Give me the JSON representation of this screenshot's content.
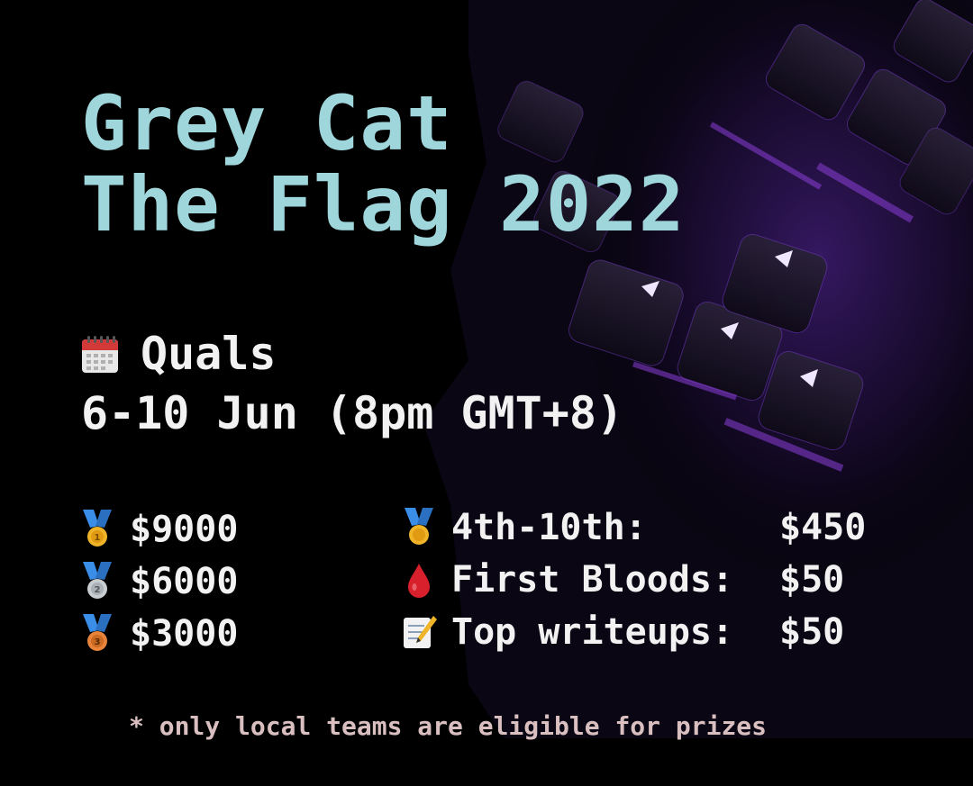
{
  "poster": {
    "title_line1": "Grey Cat",
    "title_line2": "The Flag 2022",
    "event_name": "Quals",
    "event_date": "6-10 Jun (8pm GMT+8)",
    "calendar_icon": "calendar-icon",
    "colors": {
      "background": "#000000",
      "title": "#9fd6dc",
      "text": "#f2f2f2",
      "footnote": "#d9bfc0",
      "accent_purple": "#7a3fd0"
    }
  },
  "prizes": {
    "left": [
      {
        "icon": "gold-medal-icon",
        "amount": "$9000"
      },
      {
        "icon": "silver-medal-icon",
        "amount": "$6000"
      },
      {
        "icon": "bronze-medal-icon",
        "amount": "$3000"
      }
    ],
    "right": [
      {
        "icon": "medal-icon",
        "label": "4th-10th:",
        "amount": "$450"
      },
      {
        "icon": "blood-drop-icon",
        "label": "First Bloods:",
        "amount": "$50"
      },
      {
        "icon": "memo-icon",
        "label": "Top writeups:",
        "amount": "$50"
      }
    ]
  },
  "footnote": "* only local teams are eligible for prizes"
}
